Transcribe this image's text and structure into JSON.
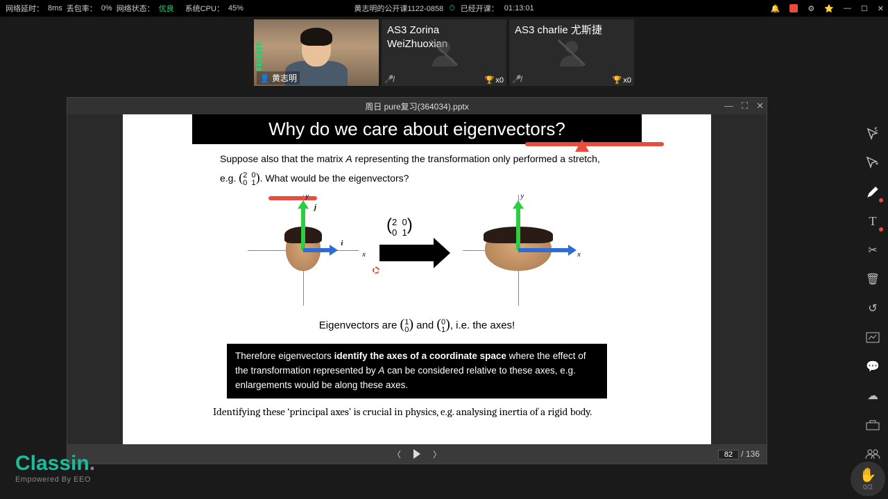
{
  "topbar": {
    "latency_label": "网络延时：",
    "latency": "8ms",
    "loss_label": "丢包率：",
    "loss": "0%",
    "net_label": "网络状态：",
    "net_status": "优良",
    "cpu_label": "系统CPU：",
    "cpu": "45%",
    "title": "黄志明的公开课1122-0858",
    "elapsed_label": "已经开课：",
    "elapsed": "01:13:01"
  },
  "videos": {
    "teacher_name": "黄志明",
    "p1_label": "AS3 Zorina WeiZhuoxian",
    "p1_score": "x0",
    "p2_label": "AS3 charlie 尤斯捷",
    "p2_score": "x0"
  },
  "doc": {
    "title": "周日 pure复习(364034).pptx"
  },
  "slide": {
    "heading": "Why do we care about eigenvectors?",
    "para_a": "Suppose also that the matrix ",
    "para_b": " representing the transformation only performed a stretch, e.g. ",
    "para_c": ". What would be the eigenvectors?",
    "matrix_small": "(2 0; 0 1)",
    "axis_x": "x",
    "axis_y": "y",
    "unit_i": "i",
    "unit_j": "j",
    "eig_a": "Eigenvectors are ",
    "eig_b": " and ",
    "eig_c": ", i.e. the axes!",
    "vec1": "(1; 0)",
    "vec2": "(0; 1)",
    "box_a": "Therefore eigenvectors ",
    "box_b": "identify the axes of a coordinate space",
    "box_c": " where the effect of the transformation represented by ",
    "box_d": " can be considered relative to these axes, e.g. enlargements would be along these axes.",
    "footer": "Identifying these ‘principal axes’ is crucial in physics, e.g. analysing inertia of a rigid body."
  },
  "pager": {
    "current": "82",
    "total": "136",
    "sep": " / "
  },
  "hand": {
    "count": "0/2"
  },
  "logo": {
    "brand": "Classin",
    "sub": "Empowered By EEO"
  }
}
